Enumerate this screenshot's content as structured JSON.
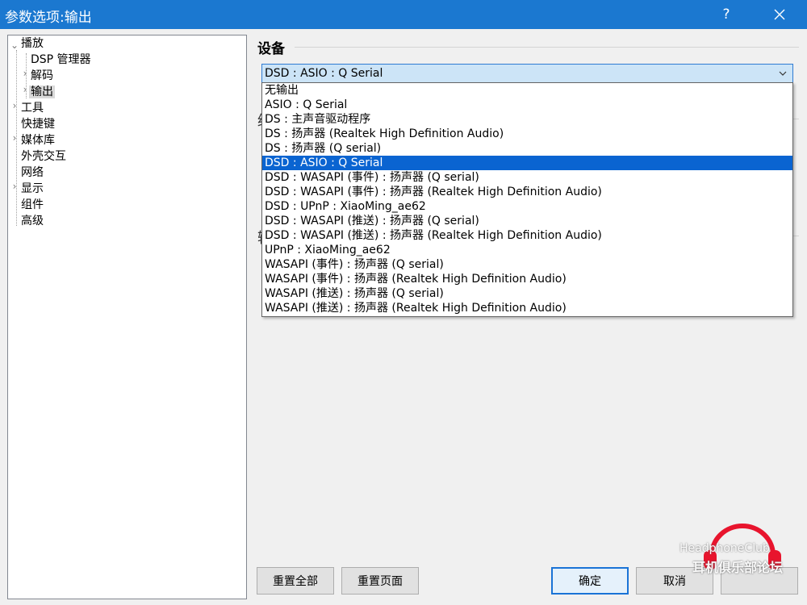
{
  "window": {
    "title": "参数选项:输出",
    "help_label": "?"
  },
  "tree": {
    "items": [
      {
        "label": "播放"
      },
      {
        "label": "DSP 管理器"
      },
      {
        "label": "解码"
      },
      {
        "label": "输出"
      },
      {
        "label": "工具"
      },
      {
        "label": "快捷键"
      },
      {
        "label": "媒体库"
      },
      {
        "label": "外壳交互"
      },
      {
        "label": "网络"
      },
      {
        "label": "显示"
      },
      {
        "label": "组件"
      },
      {
        "label": "高级"
      }
    ]
  },
  "device": {
    "section_title": "设备",
    "selected_value": "DSD : ASIO : Q Serial",
    "options": [
      "无输出",
      "ASIO : Q Serial",
      "DS : 主声音驱动程序",
      "DS : 扬声器 (Realtek High Definition Audio)",
      "DS : 扬声器 (Q serial)",
      "DSD : ASIO : Q Serial",
      "DSD : WASAPI (事件) : 扬声器 (Q serial)",
      "DSD : WASAPI (事件) : 扬声器 (Realtek High Definition Audio)",
      "DSD : UPnP : XiaoMing_ae62",
      "DSD : WASAPI (推送) : 扬声器 (Q serial)",
      "DSD : WASAPI (推送) : 扬声器 (Realtek High Definition Audio)",
      "UPnP : XiaoMing_ae62",
      "WASAPI (事件) : 扬声器 (Q serial)",
      "WASAPI (事件) : 扬声器 (Realtek High Definition Audio)",
      "WASAPI (推送) : 扬声器 (Q serial)",
      "WASAPI (推送) : 扬声器 (Realtek High Definition Audio)"
    ],
    "selected_index": 5
  },
  "hidden_section_glyphs": [
    "缓",
    "输"
  ],
  "buttons": {
    "reset_all": "重置全部",
    "reset_page": "重置页面",
    "ok": "确定",
    "cancel": "取消"
  },
  "watermark": {
    "line1": "HeadphoneClub",
    "line2": "耳机俱乐部论坛"
  },
  "colors": {
    "titlebar": "#1b78d0",
    "selection": "#0a64d1",
    "combo_bg": "#cce4f7",
    "logo_red": "#e8142d"
  }
}
